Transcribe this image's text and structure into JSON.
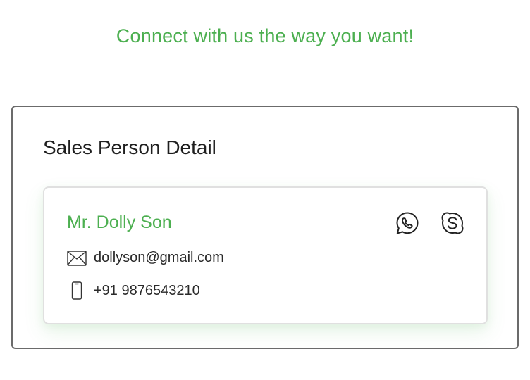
{
  "header": {
    "headline": "Connect with us the way you want!"
  },
  "sales_section": {
    "title": "Sales Person Detail",
    "person": {
      "name": "Mr. Dolly Son",
      "email": "dollyson@gmail.com",
      "phone": "+91 9876543210"
    },
    "social": [
      {
        "icon": "whatsapp-icon"
      },
      {
        "icon": "skype-icon"
      }
    ]
  },
  "colors": {
    "accent": "#4caf50",
    "text": "#2a2a2a",
    "border": "#6b6b6b"
  }
}
